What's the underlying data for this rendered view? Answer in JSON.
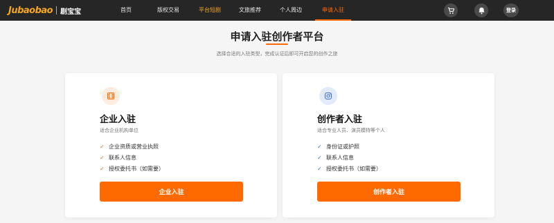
{
  "brand": {
    "logo_text": "Jubaobao",
    "name_cn": "剧宝宝",
    "accent": "#ff6a00"
  },
  "nav": {
    "items": [
      {
        "label": "首页"
      },
      {
        "label": "版权交易"
      },
      {
        "label": "平台短剧"
      },
      {
        "label": "文旅推荐"
      },
      {
        "label": "个人周边"
      },
      {
        "label": "申请入驻"
      }
    ],
    "active": "申请入驻"
  },
  "header_icons": [
    "cart-icon",
    "bell-icon"
  ],
  "login_label": "登录",
  "page": {
    "title": "申请入驻创作者平台",
    "subtitle": "选择合适的入驻类型，完成认证后即可开启您的创作之旅"
  },
  "cards": [
    {
      "icon": "film-icon",
      "icon_color": "#ff6a00",
      "title": "企业入驻",
      "desc": "适合企业机构单位",
      "check_color": "#ff6a00",
      "features": [
        "企业资质或营业执照",
        "联系人信息",
        "授权委托书（如需要）"
      ],
      "button": "企业入驻"
    },
    {
      "icon": "instagram-icon",
      "icon_color": "#3b6fd6",
      "title": "创作者入驻",
      "desc": "适合专业人员、演员模特等个人",
      "check_color": "#3b6fd6",
      "features": [
        "身份证或护照",
        "联系人信息",
        "授权委托书（如需要）"
      ],
      "button": "创作者入驻"
    }
  ]
}
